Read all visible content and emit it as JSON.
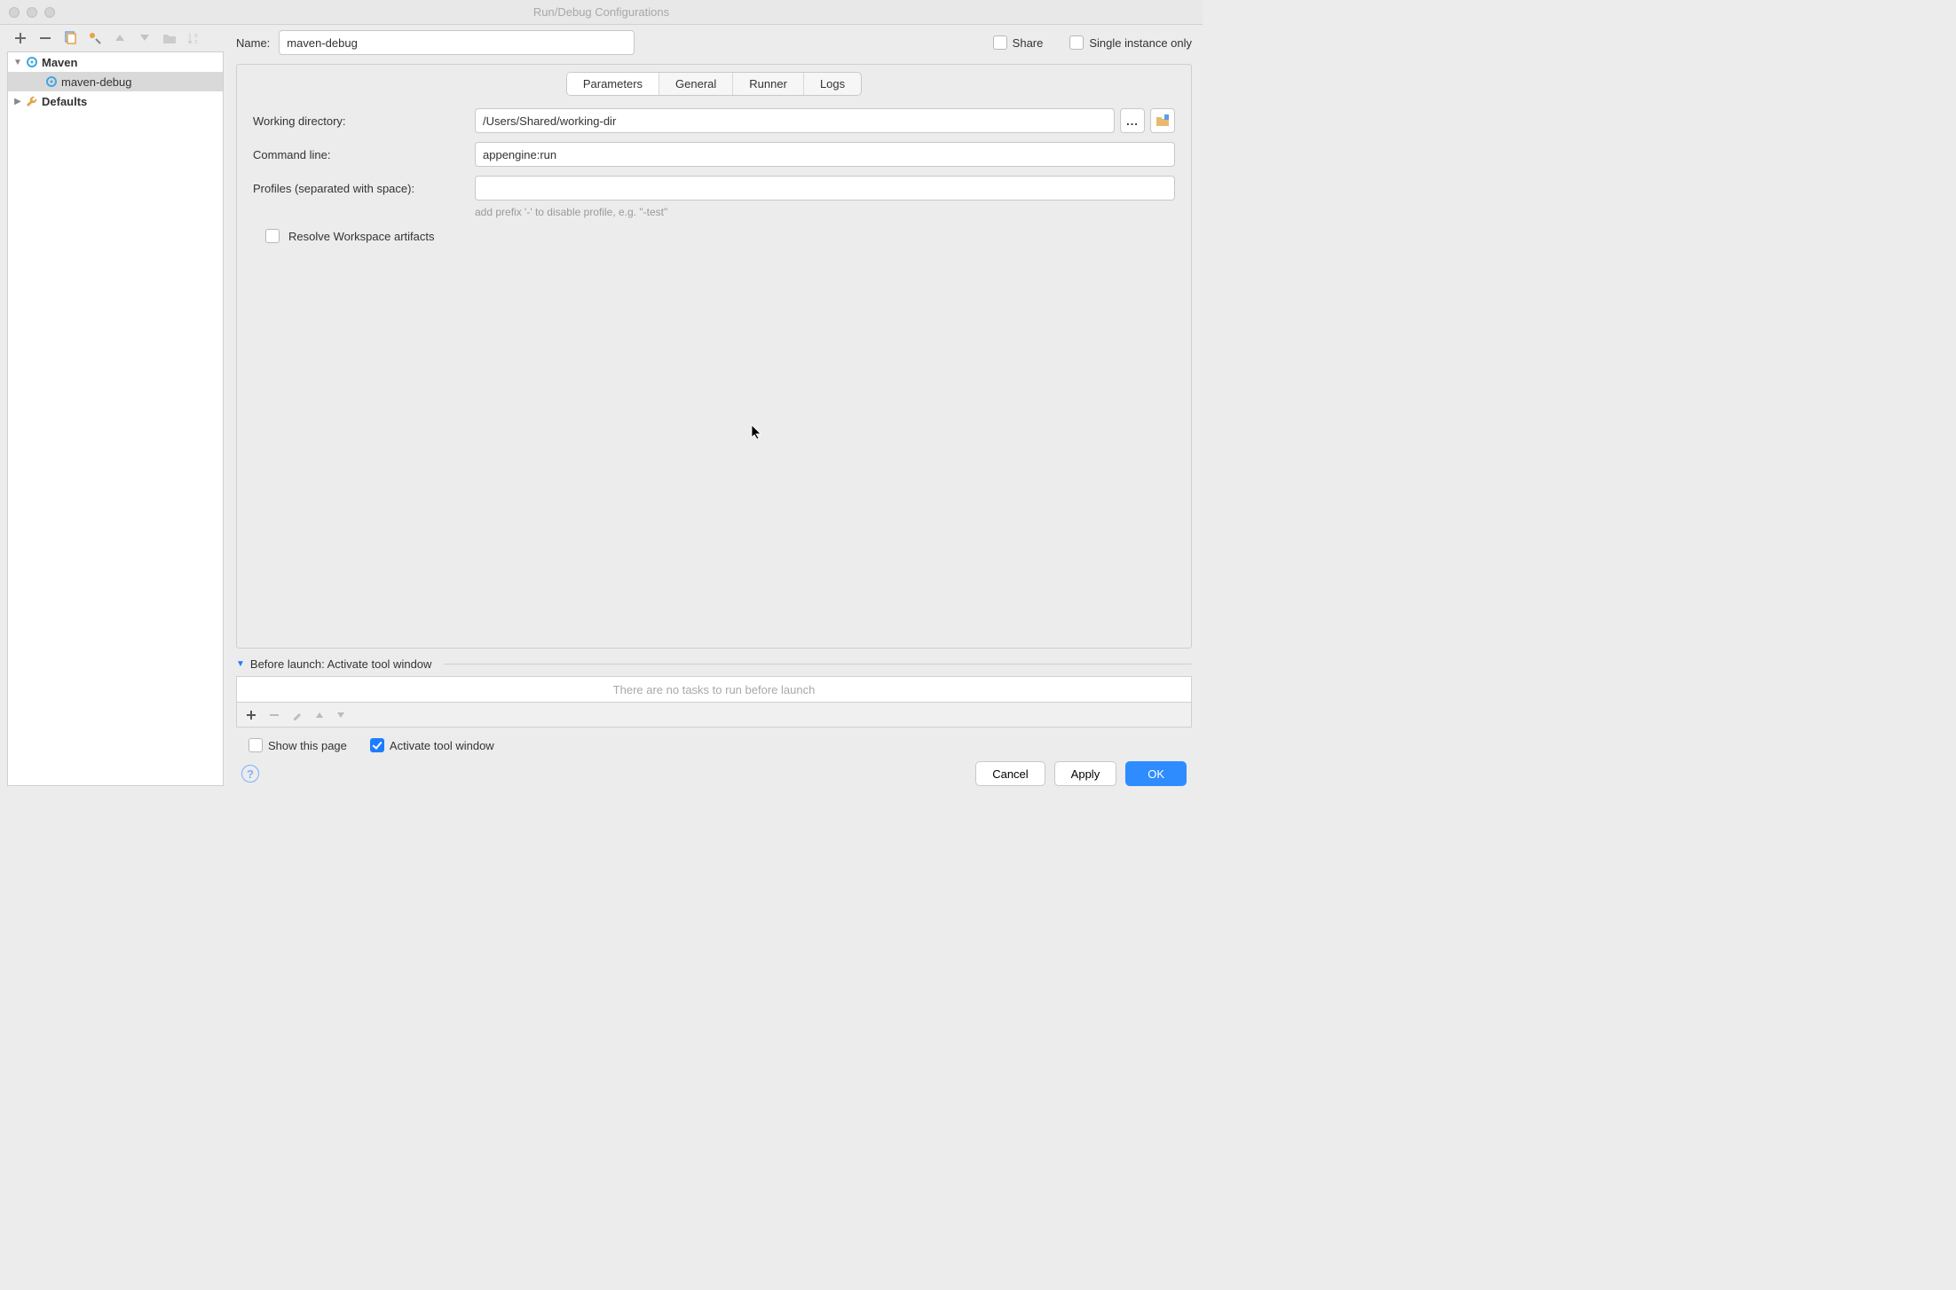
{
  "window": {
    "title": "Run/Debug Configurations"
  },
  "toolbar": {
    "add": "+",
    "remove": "−"
  },
  "sidebar": {
    "items": [
      {
        "label": "Maven",
        "expanded": true,
        "bold": true
      },
      {
        "label": "maven-debug",
        "selected": true
      },
      {
        "label": "Defaults",
        "bold": true
      }
    ]
  },
  "name": {
    "label": "Name:",
    "value": "maven-debug"
  },
  "share": {
    "label": "Share",
    "checked": false
  },
  "singleInstance": {
    "label": "Single instance only",
    "checked": false
  },
  "tabs": [
    "Parameters",
    "General",
    "Runner",
    "Logs"
  ],
  "tabSelected": 0,
  "form": {
    "workingDir": {
      "label": "Working directory:",
      "value": "/Users/Shared/working-dir"
    },
    "cmdLine": {
      "label": "Command line:",
      "value": "appengine:run"
    },
    "profiles": {
      "label": "Profiles (separated with space):",
      "value": "",
      "hint": "add prefix '-' to disable profile, e.g. \"-test\""
    },
    "resolveWs": {
      "label": "Resolve Workspace artifacts",
      "checked": false
    }
  },
  "beforeLaunch": {
    "header": "Before launch: Activate tool window",
    "emptyText": "There are no tasks to run before launch",
    "showPage": {
      "label": "Show this page",
      "checked": false
    },
    "activateTool": {
      "label": "Activate tool window",
      "checked": true
    }
  },
  "buttons": {
    "cancel": "Cancel",
    "apply": "Apply",
    "ok": "OK"
  }
}
